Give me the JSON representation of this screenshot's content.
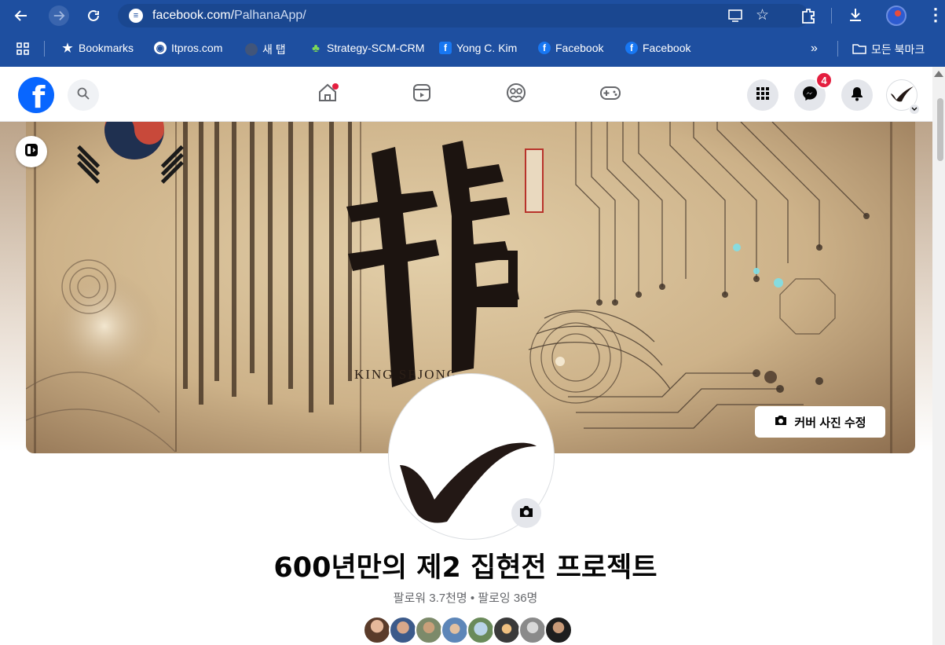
{
  "browser": {
    "url_domain": "facebook.com/",
    "url_path": "PalhanaApp/",
    "bookmarks": [
      {
        "label": "Bookmarks",
        "icon": "star-icon"
      },
      {
        "label": "Itpros.com",
        "icon": "globe-icon"
      },
      {
        "label": "새 탭",
        "icon": "tab-icon"
      },
      {
        "label": "Strategy-SCM-CRM",
        "icon": "leaf-icon"
      },
      {
        "label": "Yong C. Kim",
        "icon": "facebook-icon"
      },
      {
        "label": "Facebook",
        "icon": "facebook-icon"
      },
      {
        "label": "Facebook",
        "icon": "facebook-icon"
      }
    ],
    "overflow_label": "»",
    "all_bookmarks_label": "모든 북마크"
  },
  "fb": {
    "messenger_badge": "4",
    "edit_cover_label": "커버 사진 수정",
    "cover_text": "KING SEJONG",
    "page_name": "600년만의 제2 집현전 프로젝트",
    "followers": "팔로워 3.7천명",
    "separator": " • ",
    "following": "팔로잉 36명"
  },
  "colors": {
    "browser_blue": "#1e4fa0",
    "facebook_blue": "#0866ff",
    "badge_red": "#e41e3f"
  }
}
